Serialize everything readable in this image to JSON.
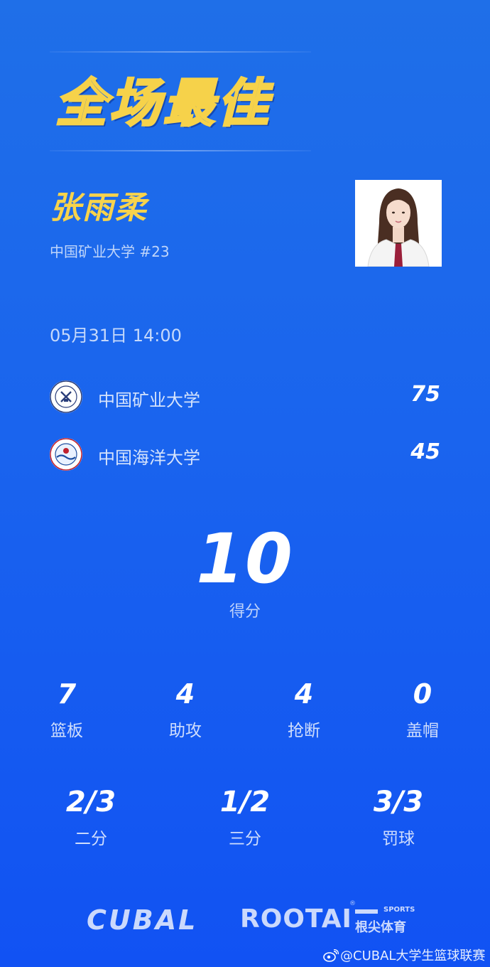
{
  "title": "全场最佳",
  "player": {
    "name": "张雨柔",
    "team_number": "中国矿业大学 #23"
  },
  "game": {
    "datetime": "05月31日 14:00",
    "teams": [
      {
        "name": "中国矿业大学",
        "score": "75",
        "logo_icon": "cumt-logo-icon"
      },
      {
        "name": "中国海洋大学",
        "score": "45",
        "logo_icon": "ouc-logo-icon"
      }
    ]
  },
  "highlight": {
    "value": "10",
    "label": "得分"
  },
  "stats_row1": [
    {
      "value": "7",
      "label": "篮板"
    },
    {
      "value": "4",
      "label": "助攻"
    },
    {
      "value": "4",
      "label": "抢断"
    },
    {
      "value": "0",
      "label": "盖帽"
    }
  ],
  "stats_row2": [
    {
      "value": "2/3",
      "label": "二分"
    },
    {
      "value": "1/2",
      "label": "三分"
    },
    {
      "value": "3/3",
      "label": "罚球"
    }
  ],
  "brands": {
    "cubal": "CUBAL",
    "rootai": "ROOTAI",
    "reg": "®",
    "sports": "SPORTS",
    "rootai_cn": "根尖体育"
  },
  "watermark": "@CUBAL大学生篮球联赛",
  "colors": {
    "background_top": "#1f6fe8",
    "background_bottom": "#1152f3",
    "accent_yellow": "#f7d34c"
  }
}
